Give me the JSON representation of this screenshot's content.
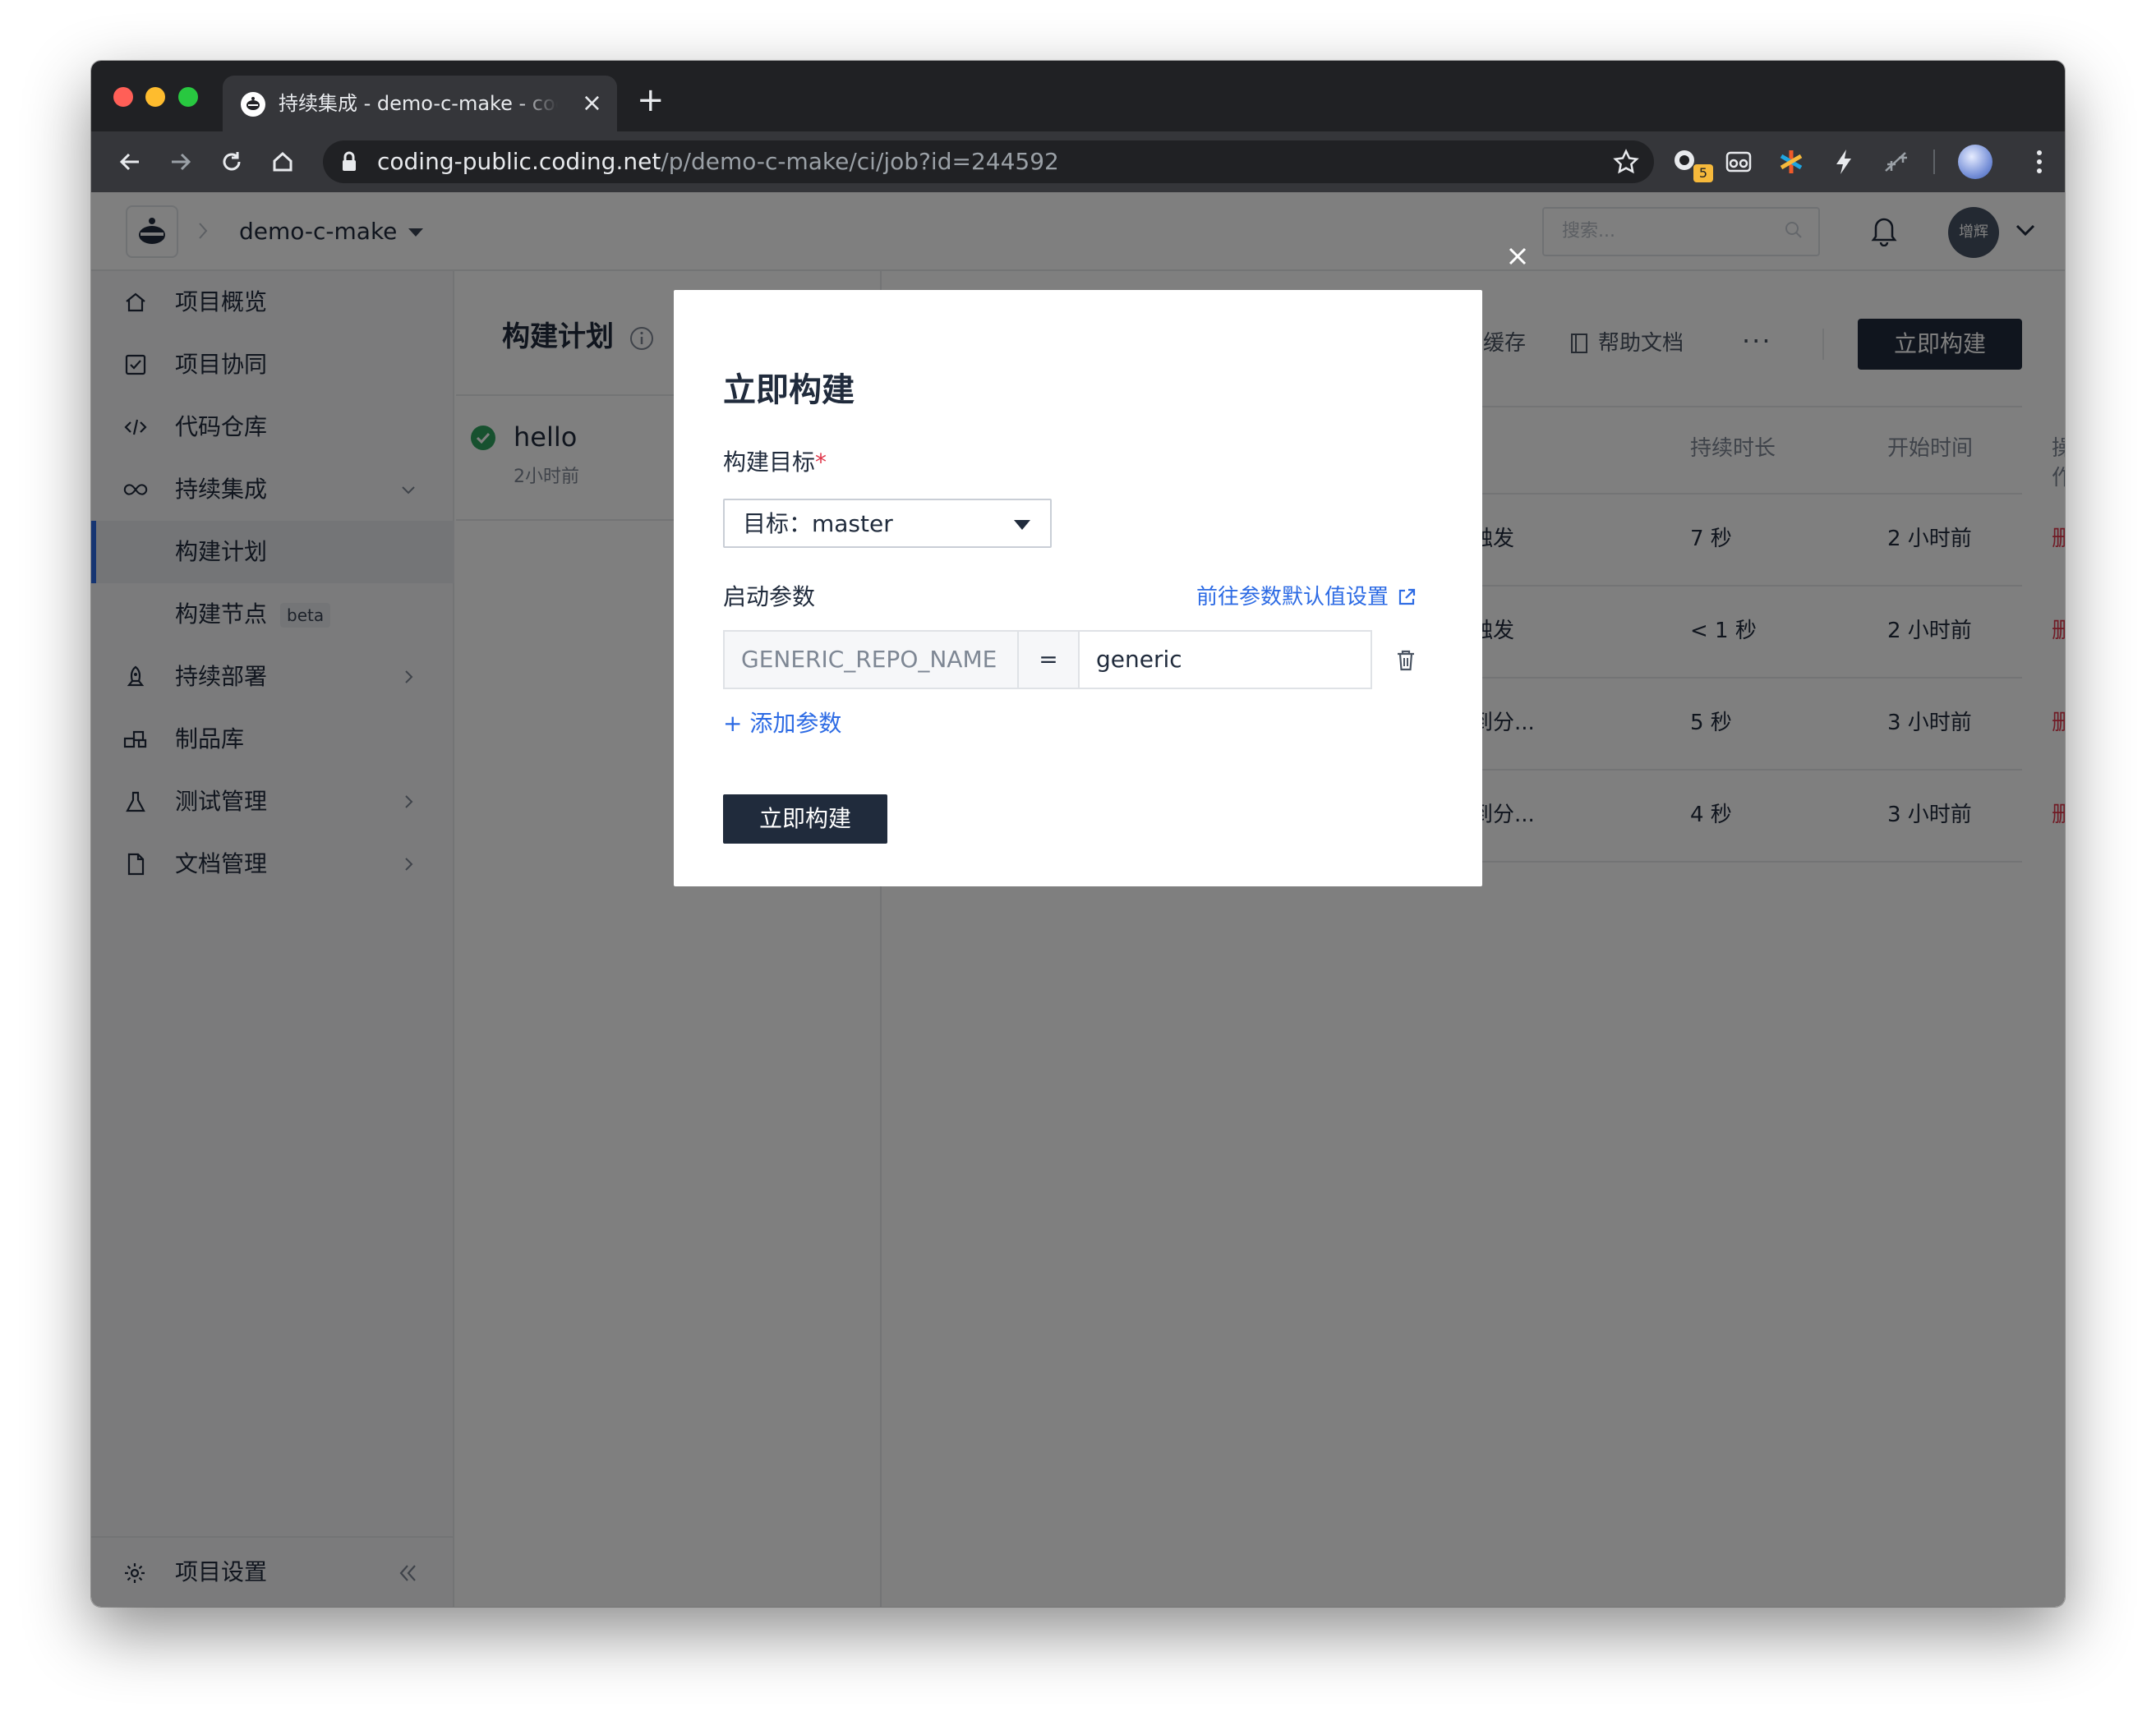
{
  "browser": {
    "tab_title": "持续集成 - demo-c-make - coding",
    "url_host": "coding-public.coding.net",
    "url_path": "/p/demo-c-make/ci/job?id=244592",
    "extension_badge": "5"
  },
  "header": {
    "project_name": "demo-c-make",
    "search_placeholder": "搜索...",
    "user_avatar_text": "增辉"
  },
  "sidebar": {
    "items": [
      {
        "label": "项目概览",
        "icon": "home-icon"
      },
      {
        "label": "项目协同",
        "icon": "checkbox-icon"
      },
      {
        "label": "代码仓库",
        "icon": "code-icon"
      },
      {
        "label": "持续集成",
        "icon": "infinity-icon"
      },
      {
        "label": "构建计划"
      },
      {
        "label": "构建节点",
        "badge": "beta"
      },
      {
        "label": "持续部署",
        "icon": "rocket-icon"
      },
      {
        "label": "制品库",
        "icon": "package-icon"
      },
      {
        "label": "测试管理",
        "icon": "flask-icon"
      },
      {
        "label": "文档管理",
        "icon": "document-icon"
      }
    ],
    "settings_label": "项目设置"
  },
  "plans": {
    "title": "构建计划",
    "items": [
      {
        "name": "hello",
        "time": "2小时前"
      }
    ]
  },
  "main": {
    "cache_label": "缓存",
    "help_label": "帮助文档",
    "build_button": "立即构建",
    "columns": [
      "持续时长",
      "开始时间",
      "操作"
    ],
    "rows": [
      {
        "trigger": "触发",
        "duration": "7 秒",
        "start": "2 小时前",
        "action": "删除"
      },
      {
        "trigger": "触发",
        "duration": "< 1 秒",
        "start": "2 小时前",
        "action": "删除"
      },
      {
        "trigger": "到分...",
        "duration": "5 秒",
        "start": "3 小时前",
        "action": "删除"
      },
      {
        "trigger": "到分...",
        "duration": "4 秒",
        "start": "3 小时前",
        "action": "删除"
      }
    ]
  },
  "modal": {
    "title": "立即构建",
    "target_label": "构建目标",
    "required_mark": "*",
    "target_value": "目标：master",
    "params_label": "启动参数",
    "defaults_link": "前往参数默认值设置",
    "param_key": "GENERIC_REPO_NAME",
    "param_eq": "=",
    "param_value": "generic",
    "add_param": "+ 添加参数",
    "submit": "立即构建"
  },
  "colors": {
    "primary_dark": "#202b3c",
    "link_blue": "#2d6be4",
    "danger_red": "#e0364a",
    "success_green": "#2fa35e"
  }
}
